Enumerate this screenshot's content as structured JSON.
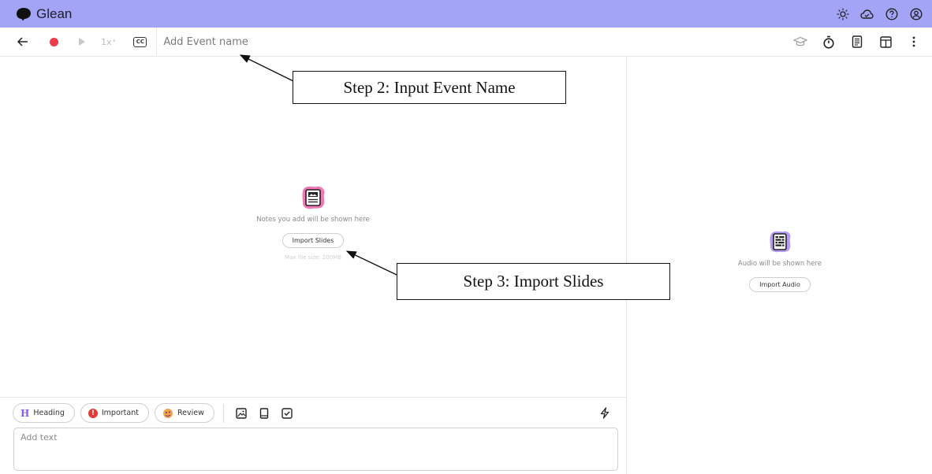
{
  "app": {
    "brand": "Glean"
  },
  "topbar": {
    "icons": [
      "sun-icon",
      "cloud-icon",
      "help-icon",
      "account-icon"
    ]
  },
  "toolbar": {
    "speed_label": "1x⁺",
    "cc_label": "CC",
    "event_name_placeholder": "Add Event name",
    "event_name_value": "",
    "right_icons": [
      "graduation-cap-icon",
      "timer-icon",
      "document-icon",
      "layout-icon",
      "more-vertical-icon"
    ]
  },
  "notes_pane": {
    "empty_text": "Notes you add will be shown here",
    "import_button": "Import Slides",
    "max_size": "Max file size: 200MB"
  },
  "audio_pane": {
    "empty_text": "Audio will be shown here",
    "import_button": "Import Audio"
  },
  "composer": {
    "tags": [
      {
        "label": "Heading",
        "glyph": "H"
      },
      {
        "label": "Important",
        "glyph": "!"
      },
      {
        "label": "Review"
      }
    ],
    "tools": [
      "image-icon",
      "tablet-icon",
      "checkbox-icon",
      "bolt-icon"
    ],
    "text_placeholder": "Add text",
    "text_value": ""
  },
  "annotations": {
    "step2": "Step 2: Input Event Name",
    "step3": "Step 3: Import Slides"
  },
  "colors": {
    "topbar": "#a4a4f6",
    "record": "#ee3b4c",
    "accent_pink": "#ee5fa8",
    "accent_purple": "#8a5be8"
  }
}
